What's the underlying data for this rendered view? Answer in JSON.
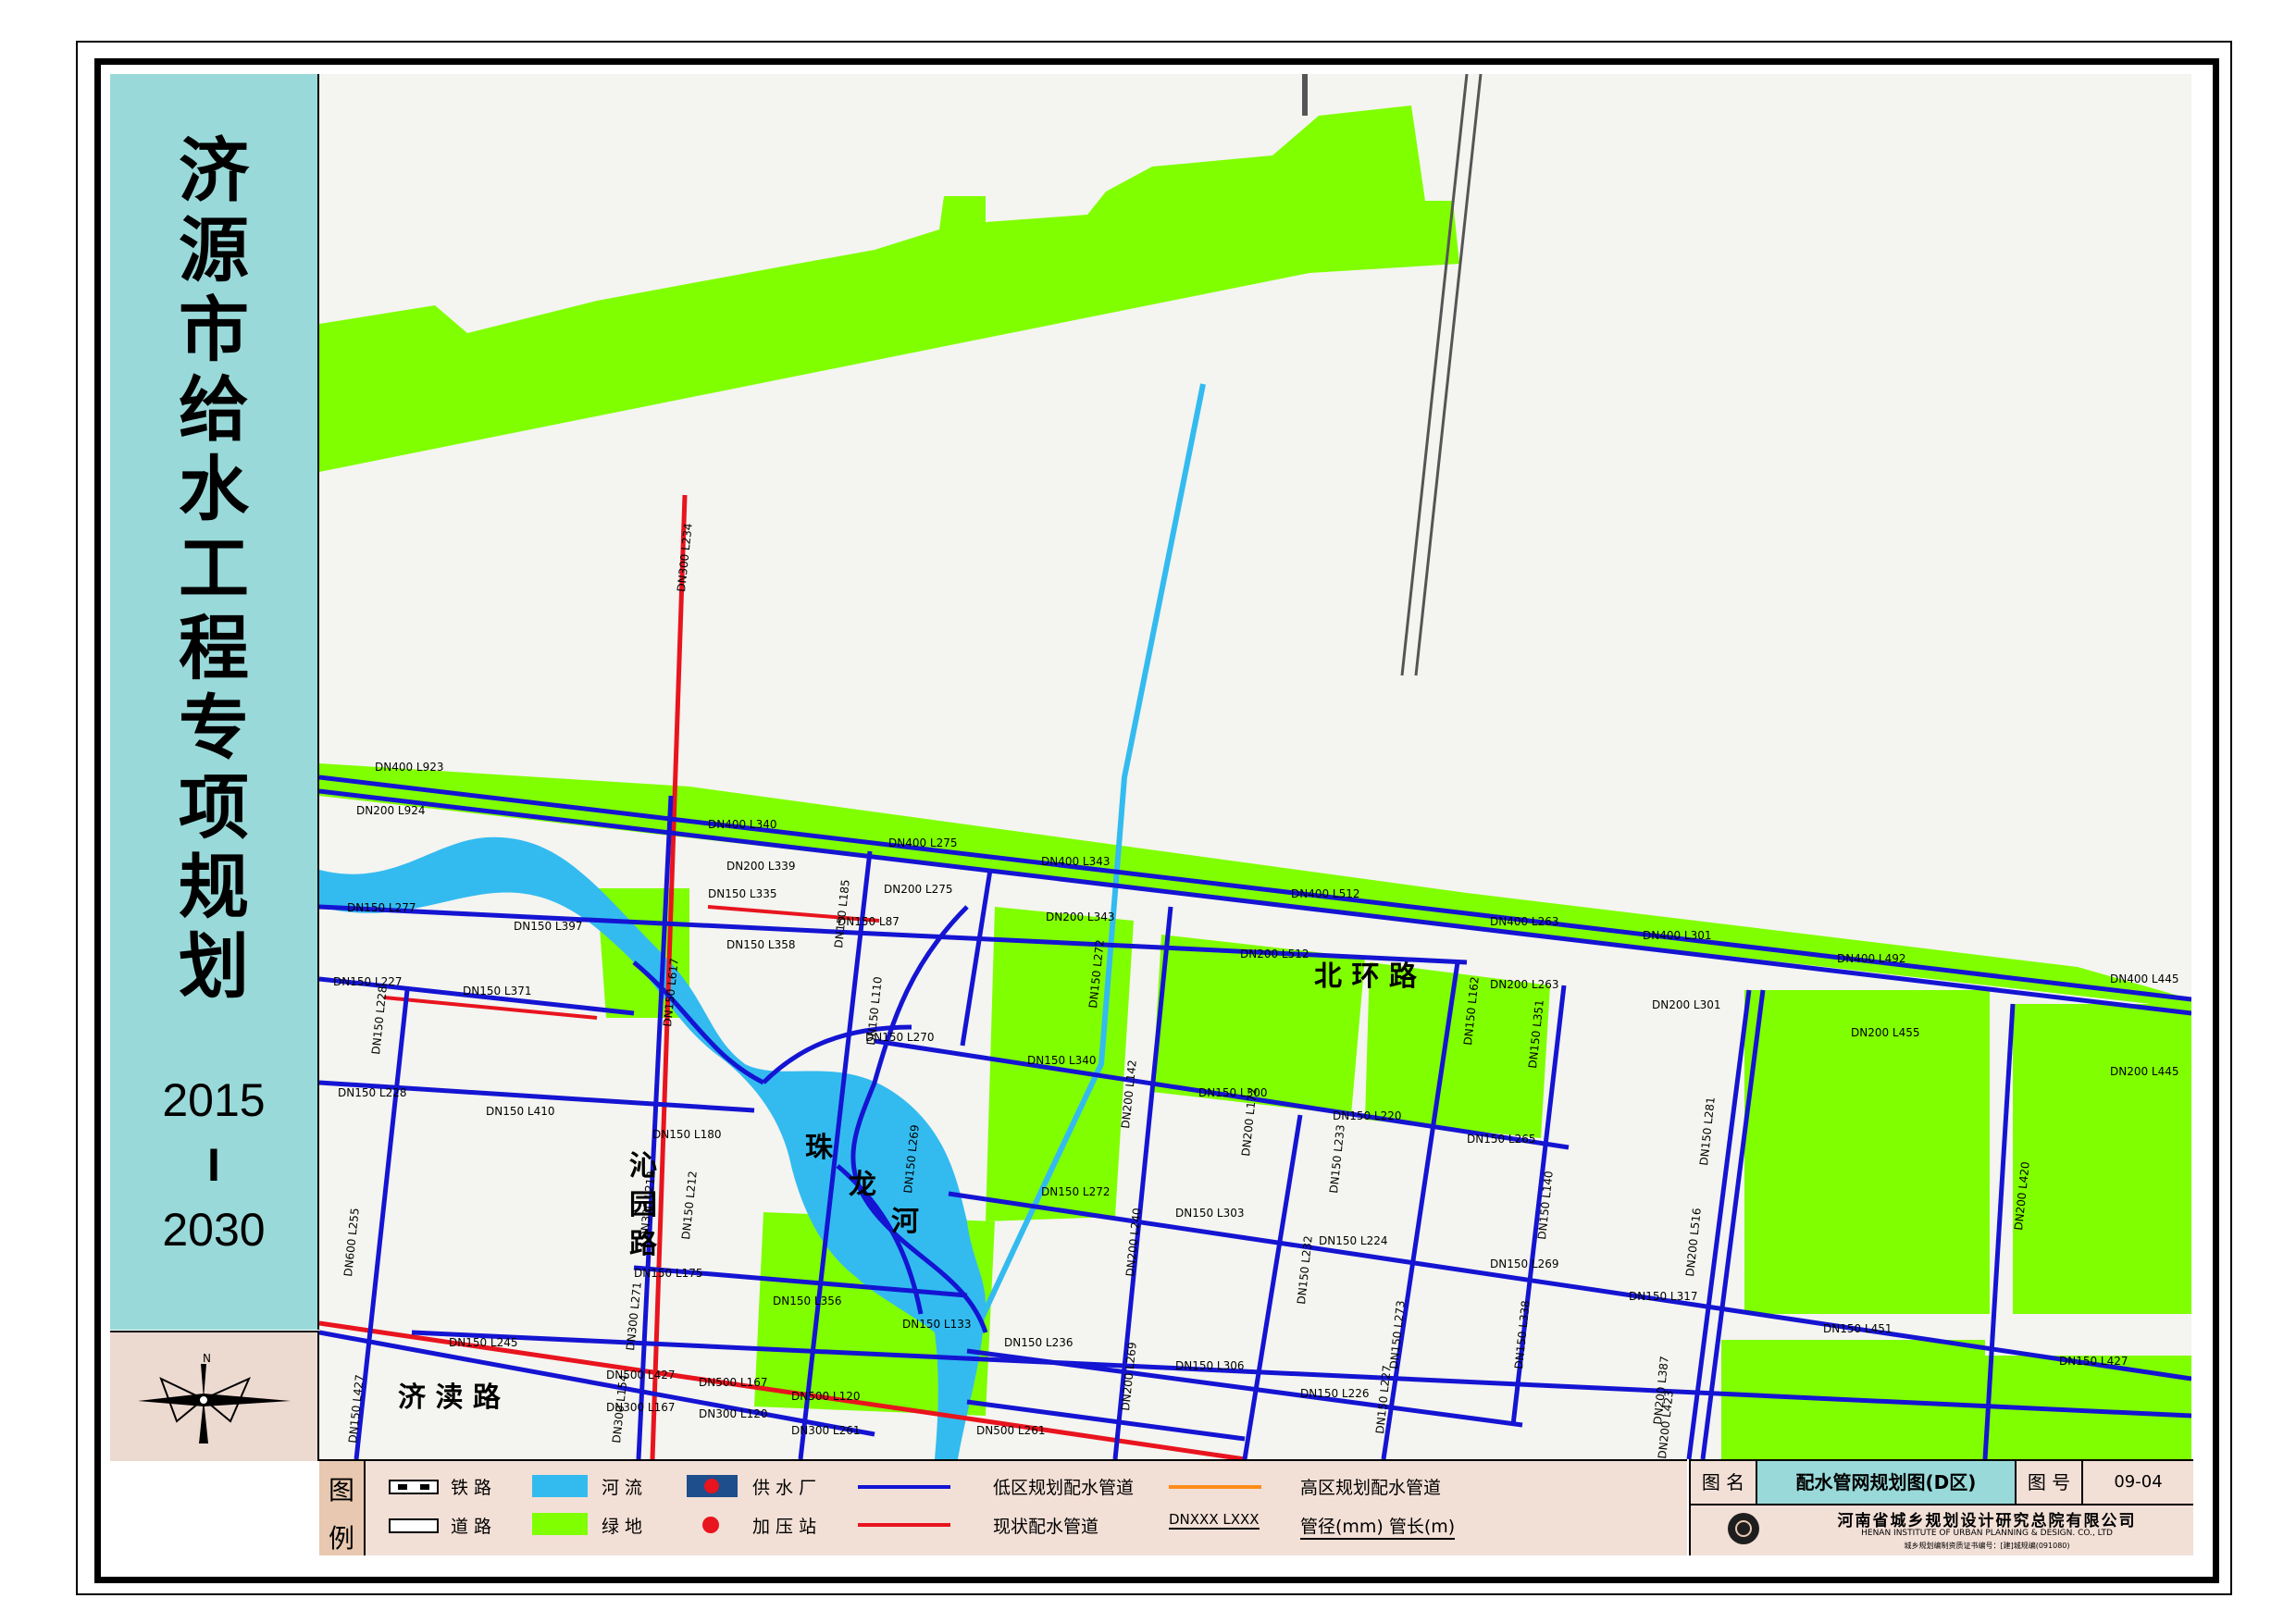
{
  "side": {
    "title_chars": [
      "济",
      "源",
      "市",
      "给",
      "水",
      "工",
      "程",
      "专",
      "项",
      "规",
      "划"
    ],
    "year_start": "2015",
    "year_sep": "I",
    "year_end": "2030"
  },
  "roads": {
    "north_ring": "北 环 路",
    "qinyuan_1": "沁",
    "qinyuan_2": "园",
    "qinyuan_3": "路",
    "jidu": "济 渎 路"
  },
  "river": {
    "c1": "珠",
    "c2": "龙",
    "c3": "河"
  },
  "pipe_labels": [
    "DN400 L923",
    "DN200 L924",
    "DN400 L340",
    "DN400 L275",
    "DN400 L343",
    "DN400 L512",
    "DN400 L263",
    "DN400 L301",
    "DN400 L492",
    "DN400 L445",
    "DN200 L339",
    "DN200 L275",
    "DN200 L343",
    "DN200 L512",
    "DN200 L263",
    "DN200 L301",
    "DN200 L455",
    "DN200 L445",
    "DN150 L277",
    "DN150 L397",
    "DN150 L227",
    "DN150 L371",
    "DN150 L335",
    "DN150 L87",
    "DN150 L358",
    "DN150 L270",
    "DN150 L340",
    "DN150 L300",
    "DN150 L220",
    "DN150 L265",
    "DN150 L410",
    "DN150 L180",
    "DN150 L228",
    "DN150 L303",
    "DN150 L224",
    "DN150 L269",
    "DN150 L317",
    "DN150 L451",
    "DN150 L427",
    "DN150 L175",
    "DN150 L356",
    "DN150 L133",
    "DN150 L236",
    "DN150 L306",
    "DN150 L226",
    "DN150 L272",
    "DN150 L245",
    "DN500 L427",
    "DN300 L167",
    "DN500 L167",
    "DN300 L120",
    "DN500 L120",
    "DN300 L261",
    "DN500 L261",
    "DN300 L234",
    "DN150 L617",
    "DN300 L212",
    "DN300 L271",
    "DN300 L154",
    "DN600 L255",
    "DN150 L427",
    "DN150 L228",
    "DN150 L212",
    "DN150 L185",
    "DN150 L110",
    "DN150 L269",
    "DN150 L272",
    "DN200 L142",
    "DN200 L240",
    "DN200 L269",
    "DN200 L172",
    "DN150 L233",
    "DN150 L232",
    "DN150 L273",
    "DN150 L227",
    "DN150 L162",
    "DN150 L351",
    "DN150 L140",
    "DN150 L338",
    "DN150 L281",
    "DN200 L516",
    "DN200 L387",
    "DN200 L423",
    "DN200 L420",
    "DN150 L573"
  ],
  "legend": {
    "head_1": "图",
    "head_2": "例",
    "railway": "铁 路",
    "road": "道 路",
    "river": "河 流",
    "green": "绿 地",
    "plant": "供 水 厂",
    "booster": "加 压 站",
    "low_pipe": "低区规划配水管道",
    "exist_pipe": "现状配水管道",
    "high_pipe": "高区规划配水管道",
    "sample": "DNXXX   LXXX",
    "sample_desc": "管径(mm)  管长(m)"
  },
  "titleblock": {
    "name_label": "图 名",
    "name": "配水管网规划图(D区)",
    "no_label": "图 号",
    "no": "09-04",
    "company": "河南省城乡规划设计研究总院有限公司",
    "company_en": "HENAN INSTITUTE OF URBAN PLANNING & DESIGN. CO., LTD",
    "cert": "城乡规划编制资质证书编号：[建]城规编(091080)"
  },
  "colors": {
    "green": "#80ff00",
    "river": "#33bbf0",
    "low_pipe": "#1414d2",
    "exist_pipe": "#e8141e",
    "high_pipe": "#ff8c1a",
    "panel": "#99d9d9"
  },
  "icons": [
    "north-arrow-icon",
    "railway-icon",
    "road-icon",
    "river-icon",
    "green-icon",
    "plant-icon",
    "booster-icon"
  ]
}
